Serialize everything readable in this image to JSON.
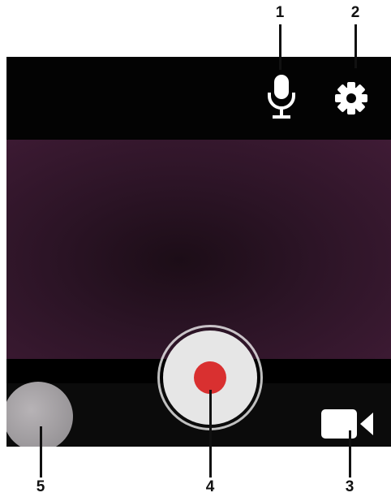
{
  "callouts": [
    "1",
    "2",
    "3",
    "4",
    "5"
  ],
  "icons": {
    "microphone": "microphone-icon",
    "settings": "gear-icon",
    "video_mode": "video-camera-icon",
    "record": "record-button",
    "gallery": "gallery-thumbnail"
  },
  "colors": {
    "record_red": "#d93030",
    "viewfinder_purple": "#3f1b35",
    "bar_black": "#030303",
    "button_grey": "#e6e6e6"
  }
}
